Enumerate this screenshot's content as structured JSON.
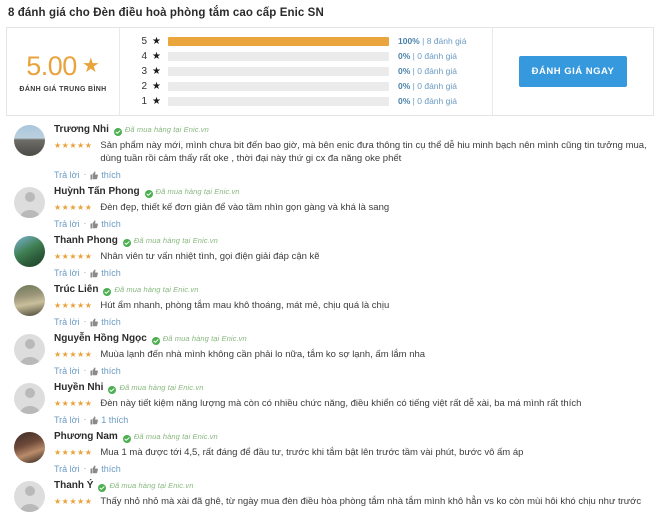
{
  "header": {
    "title": "8 đánh giá cho Đèn điều hoà phòng tắm cao cấp Enic SN"
  },
  "colors": {
    "accent_orange": "#eaa63c",
    "cta_blue": "#3699dd",
    "link_blue": "#6b9bc3",
    "verified_green": "#87b77e",
    "track_grey": "#ebebeb"
  },
  "summary": {
    "average": "5.00",
    "average_star_icon": "star-icon",
    "average_label": "ĐÁNH GIÁ TRUNG BÌNH",
    "cta_label": "ĐÁNH GIÁ NGAY",
    "distribution": [
      {
        "stars": "5",
        "star_icon": "star-icon",
        "percent": 100,
        "percent_label": "100%",
        "separator": "|",
        "count_label": "8 đánh giá"
      },
      {
        "stars": "4",
        "star_icon": "star-icon",
        "percent": 0,
        "percent_label": "0%",
        "separator": "|",
        "count_label": "0 đánh giá"
      },
      {
        "stars": "3",
        "star_icon": "star-icon",
        "percent": 0,
        "percent_label": "0%",
        "separator": "|",
        "count_label": "0 đánh giá"
      },
      {
        "stars": "2",
        "star_icon": "star-icon",
        "percent": 0,
        "percent_label": "0%",
        "separator": "|",
        "count_label": "0 đánh giá"
      },
      {
        "stars": "1",
        "star_icon": "star-icon",
        "percent": 0,
        "percent_label": "0%",
        "separator": "|",
        "count_label": "0 đánh giá"
      }
    ]
  },
  "reviews": {
    "verified_text": "Đã mua hàng tại Enic.vn",
    "verified_icon": "check-circle-icon",
    "stars_glyphs": "★★★★★",
    "reply_label": "Trả lời",
    "separator": "·",
    "thumb_icon": "thumbs-up-icon",
    "items": [
      {
        "name": "Trương Nhi",
        "avatar": "photo-avatar-beach",
        "rating": 5,
        "text": "Sản phẩm này mới, mình chưa bit đến bao giờ, mà bên enic đưa thông tin cụ thể dễ hiu minh bạch nên mình cũng tin tưởng mua, dùng tuần rồi cảm thấy rất oke , thời đại này thứ gi cx đa năng oke phết",
        "like_label": "thích"
      },
      {
        "name": "Huỳnh Tấn Phong",
        "avatar": "default-avatar",
        "rating": 5,
        "text": "Đèn đẹp, thiết kế đơn giản để vào tầm nhìn gọn gàng và khá là sang",
        "like_label": "thích"
      },
      {
        "name": "Thanh Phong",
        "avatar": "photo-avatar-pool",
        "rating": 5,
        "text": "Nhân viên tư vấn nhiệt tình, gọi điện giải đáp cận kẽ",
        "like_label": "thích"
      },
      {
        "name": "Trúc Liên",
        "avatar": "photo-avatar-outdoor",
        "rating": 5,
        "text": "Hút ẩm nhanh, phòng tắm mau khô thoáng, mát mẻ, chịu quá là chịu",
        "like_label": "thích"
      },
      {
        "name": "Nguyễn Hồng Ngọc",
        "avatar": "default-avatar",
        "rating": 5,
        "text": "Muùa lạnh đến nhà mình không cần phải lo nữa, tắm ko sợ lạnh, ấm lắm nha",
        "like_label": "thích"
      },
      {
        "name": "Huyền Nhi",
        "avatar": "default-avatar",
        "rating": 5,
        "text": "Đèn này tiết kiệm năng lượng mà còn có nhiều chức năng, điều khiển có tiếng việt rất dễ xài, ba má mình rất thích",
        "like_label": "1 thích"
      },
      {
        "name": "Phương Nam",
        "avatar": "photo-avatar-portrait",
        "rating": 5,
        "text": "Mua 1 mà được tới 4,5, rất đáng để đầu tư, trước khi tắm bật lên trước tầm vài phút, bước vô ấm áp",
        "like_label": "thích"
      },
      {
        "name": "Thanh Ý",
        "avatar": "default-avatar",
        "rating": 5,
        "text": "Thấy nhỏ nhỏ mà xài đã ghê, từ ngày mua đèn điều hòa phòng tắm nhà tắm mình khô hẳn vs ko còn mùi hôi khó chịu như trước",
        "like_label": ""
      }
    ]
  }
}
